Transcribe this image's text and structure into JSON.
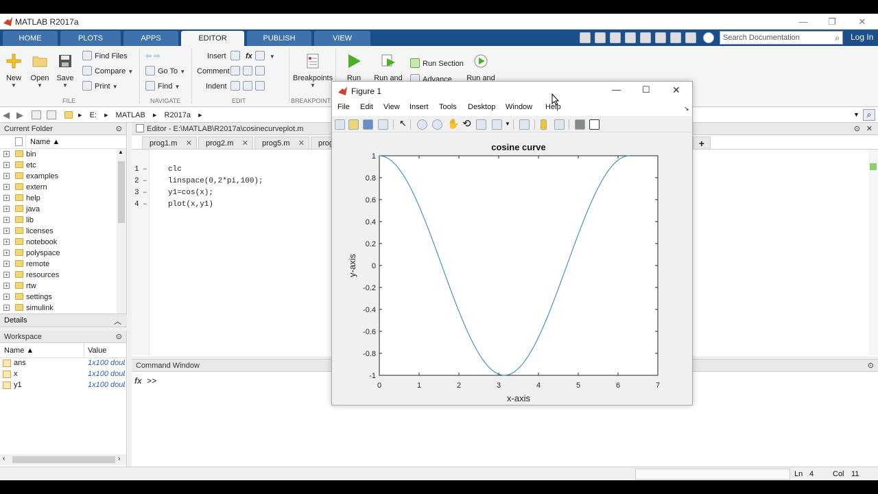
{
  "window": {
    "title": "MATLAB R2017a"
  },
  "ribbon_tabs": [
    {
      "label": "HOME"
    },
    {
      "label": "PLOTS"
    },
    {
      "label": "APPS"
    },
    {
      "label": "EDITOR"
    },
    {
      "label": "PUBLISH"
    },
    {
      "label": "VIEW"
    }
  ],
  "toolbar": {
    "search_placeholder": "Search Documentation",
    "login_label": "Log In"
  },
  "ribbon": {
    "file": {
      "new": "New",
      "open": "Open",
      "save": "Save",
      "find_files": "Find Files",
      "compare": "Compare",
      "print": "Print",
      "label": "FILE"
    },
    "navigate": {
      "goto": "Go To",
      "find": "Find",
      "label": "NAVIGATE"
    },
    "edit": {
      "insert": "Insert",
      "comment": "Comment",
      "indent": "Indent",
      "label": "EDIT",
      "fx": "fx"
    },
    "breakpoints": {
      "btn": "Breakpoints",
      "label": "BREAKPOINTS"
    },
    "run": {
      "run": "Run",
      "run_and_advance": "Run and",
      "run_section": "Run Section",
      "advance": "Advance",
      "run_and_time": "Run and"
    }
  },
  "address": {
    "crumbs": [
      "E:",
      "MATLAB",
      "R2017a"
    ]
  },
  "current_folder": {
    "title": "Current Folder",
    "col_name": "Name ▲",
    "items": [
      "bin",
      "etc",
      "examples",
      "extern",
      "help",
      "java",
      "lib",
      "licenses",
      "notebook",
      "polyspace",
      "remote",
      "resources",
      "rtw",
      "settings",
      "simulink"
    ]
  },
  "details": {
    "title": "Details"
  },
  "workspace": {
    "title": "Workspace",
    "col_name": "Name ▲",
    "col_value": "Value",
    "rows": [
      {
        "name": "ans",
        "value": "1x100 doub"
      },
      {
        "name": "x",
        "value": "1x100 doub"
      },
      {
        "name": "y1",
        "value": "1x100 doub"
      }
    ]
  },
  "editor": {
    "title": "Editor - E:\\MATLAB\\R2017a\\cosinecurveplot.m",
    "tabs": [
      "prog1.m",
      "prog2.m",
      "prog5.m",
      "prog"
    ],
    "add_tab": "+",
    "lines": [
      {
        "num": "1",
        "code": "clc"
      },
      {
        "num": "2",
        "code": "linspace(0,2*pi,100);"
      },
      {
        "num": "3",
        "code": "y1=cos(x);"
      },
      {
        "num": "4",
        "code": "plot(x,y1)"
      }
    ],
    "dash": "–"
  },
  "command_window": {
    "title": "Command Window",
    "fx": "fx",
    "prompt": ">>"
  },
  "status": {
    "ln_label": "Ln",
    "ln": "4",
    "col_label": "Col",
    "col": "11"
  },
  "figure": {
    "title": "Figure 1",
    "menu": [
      "File",
      "Edit",
      "View",
      "Insert",
      "Tools",
      "Desktop",
      "Window",
      "Help"
    ]
  },
  "chart_data": {
    "type": "line",
    "title": "cosine curve",
    "xlabel": "x-axis",
    "ylabel": "y-axis",
    "xlim": [
      0,
      7
    ],
    "ylim": [
      -1,
      1
    ],
    "xticks": [
      "0",
      "1",
      "2",
      "3",
      "4",
      "5",
      "6",
      "7"
    ],
    "yticks": [
      "-1",
      "-0.8",
      "-0.6",
      "-0.4",
      "-0.2",
      "0",
      "0.2",
      "0.4",
      "0.6",
      "0.8",
      "1"
    ],
    "series": [
      {
        "function": "cos",
        "x_start": 0,
        "x_end": 6.2832,
        "points": 100,
        "color": "#2a7fb8"
      }
    ],
    "grid": false
  },
  "colors": {
    "tab_strip": "#1a4f8a",
    "accent": "#2a7fb8"
  }
}
